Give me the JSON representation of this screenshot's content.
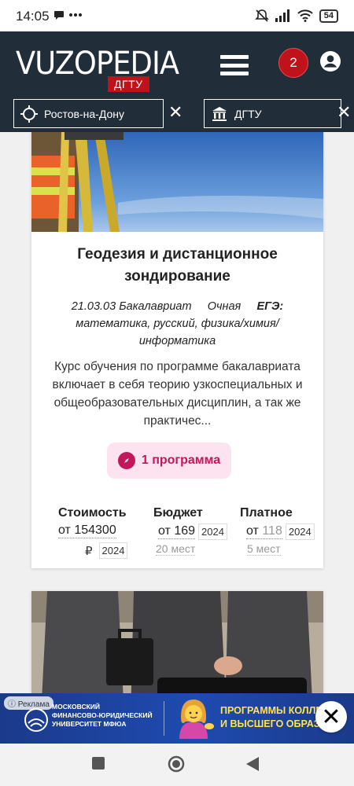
{
  "status_bar": {
    "time": "14:05",
    "battery": "54",
    "icons": [
      "message-icon",
      "more-icon",
      "mute-icon",
      "signal-icon",
      "wifi-icon",
      "battery-icon"
    ]
  },
  "header": {
    "logo": "VUZOPEDIA",
    "logo_badge": "ДГТУ",
    "cart_count": "2",
    "city_filter": "Ростов-на-Дону",
    "uni_filter": "ДГТУ",
    "clear_symbol": "✕"
  },
  "card": {
    "title": "Геодезия и дистанционное зондирование",
    "code": "21.03.03",
    "level": "Бакалавриат",
    "form": "Очная",
    "exam_label": "ЕГЭ:",
    "exams": "математика, русский, физика/химия/информатика",
    "description": "Курс обучения по программе бакалавриата включает в себя теорию узкоспециальных и общеобразовательных дисциплин, а так же практичес...",
    "programs_label": "1 программа",
    "cost": {
      "label": "Стоимость",
      "value": "от 154300",
      "currency": "₽",
      "year": "2024"
    },
    "budget": {
      "label": "Бюджет",
      "value": "от 169",
      "year": "2024",
      "seats": "20 мест"
    },
    "paid": {
      "label": "Платное",
      "prefix": "от",
      "value": "118",
      "year": "2024",
      "seats": "5 мест"
    }
  },
  "ad": {
    "tag": "Реклама",
    "uni_line1": "МОСКОВСКИЙ",
    "uni_line2": "ФИНАНСОВО-ЮРИДИЧЕСКИЙ",
    "uni_line3": "УНИВЕРСИТЕТ МФЮА",
    "promo_line1": "ПРОГРАММЫ КОЛЛЕ",
    "promo_line2": "И ВЫСШЕГО ОБРАЗОВ",
    "close_symbol": "✕"
  },
  "colors": {
    "header_bg": "#212d39",
    "accent_red": "#c0121b",
    "programs_bg": "#fde3ef",
    "programs_text": "#c2185b",
    "ad_bg": "#1e4bb0",
    "ad_promo": "#ffe44d"
  }
}
